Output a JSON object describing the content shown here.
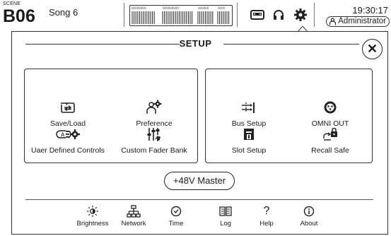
{
  "status_bar": {
    "scene_caption": "SCENE",
    "scene_number": "B06",
    "scene_name": "Song 6",
    "meter_tiny_labels": [
      "00000000",
      "000000000",
      "000000",
      "0000"
    ],
    "time": "19:30:17",
    "user": "Administrator",
    "icons": [
      "recorder-icon",
      "headphones-icon",
      "setup-gear-icon",
      "user-icon"
    ]
  },
  "dialog": {
    "title": "SETUP",
    "close_symbol": "✕",
    "left_panel": {
      "items": [
        {
          "label": "Save/Load",
          "icon": "save-load-icon"
        },
        {
          "label": "Preference",
          "icon": "preference-icon"
        },
        {
          "label": "Uaer Defined Controls",
          "icon": "user-defined-controls-icon"
        },
        {
          "label": "Custom Fader Bank",
          "icon": "custom-fader-bank-icon"
        }
      ]
    },
    "right_panel": {
      "items": [
        {
          "label": "Bus Setup",
          "icon": "bus-setup-icon"
        },
        {
          "label": "OMNI OUT",
          "icon": "omni-out-icon"
        },
        {
          "label": "Slot Setup",
          "icon": "slot-setup-icon"
        },
        {
          "label": "Recall Safe",
          "icon": "recall-safe-icon"
        }
      ]
    },
    "phantom_button": "+48V Master",
    "footer": [
      {
        "label": "Brightness",
        "icon": "brightness-icon"
      },
      {
        "label": "Network",
        "icon": "network-icon"
      },
      {
        "label": "Time",
        "icon": "clock-icon"
      },
      {
        "label": "Log",
        "icon": "log-book-icon"
      },
      {
        "label": "Help",
        "icon": "help-icon"
      },
      {
        "label": "About",
        "icon": "info-icon"
      }
    ],
    "user_defined_icon_text": "A"
  }
}
